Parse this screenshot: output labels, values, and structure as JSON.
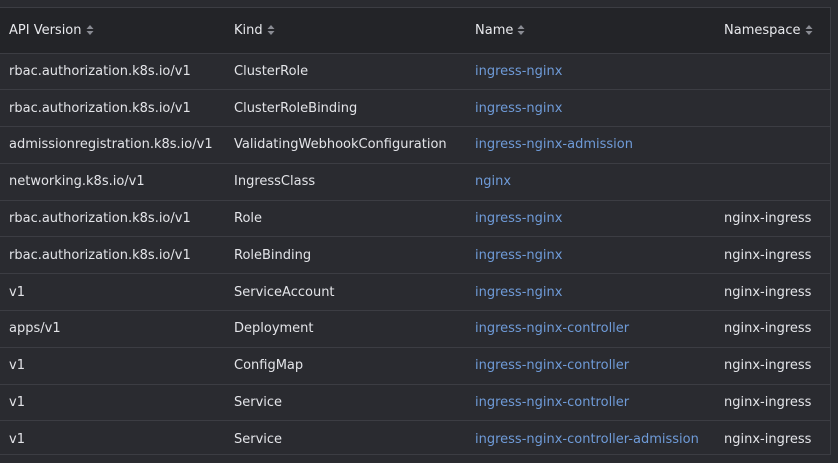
{
  "columns": [
    {
      "label": "API Version",
      "icon": "sort-icon"
    },
    {
      "label": "Kind",
      "icon": "sort-icon"
    },
    {
      "label": "Name",
      "icon": "sort-icon"
    },
    {
      "label": "Namespace",
      "icon": "sort-icon"
    }
  ],
  "colors": {
    "background": "#2a2b30",
    "header_background": "#232428",
    "border": "#3c3d43",
    "text": "#e3e4e8",
    "link": "#6f9bd8"
  },
  "rows": [
    {
      "api_version": "rbac.authorization.k8s.io/v1",
      "kind": "ClusterRole",
      "name": "ingress-nginx",
      "namespace": ""
    },
    {
      "api_version": "rbac.authorization.k8s.io/v1",
      "kind": "ClusterRoleBinding",
      "name": "ingress-nginx",
      "namespace": ""
    },
    {
      "api_version": "admissionregistration.k8s.io/v1",
      "kind": "ValidatingWebhookConfiguration",
      "name": "ingress-nginx-admission",
      "namespace": ""
    },
    {
      "api_version": "networking.k8s.io/v1",
      "kind": "IngressClass",
      "name": "nginx",
      "namespace": ""
    },
    {
      "api_version": "rbac.authorization.k8s.io/v1",
      "kind": "Role",
      "name": "ingress-nginx",
      "namespace": "nginx-ingress"
    },
    {
      "api_version": "rbac.authorization.k8s.io/v1",
      "kind": "RoleBinding",
      "name": "ingress-nginx",
      "namespace": "nginx-ingress"
    },
    {
      "api_version": "v1",
      "kind": "ServiceAccount",
      "name": "ingress-nginx",
      "namespace": "nginx-ingress"
    },
    {
      "api_version": "apps/v1",
      "kind": "Deployment",
      "name": "ingress-nginx-controller",
      "namespace": "nginx-ingress"
    },
    {
      "api_version": "v1",
      "kind": "ConfigMap",
      "name": "ingress-nginx-controller",
      "namespace": "nginx-ingress"
    },
    {
      "api_version": "v1",
      "kind": "Service",
      "name": "ingress-nginx-controller",
      "namespace": "nginx-ingress"
    },
    {
      "api_version": "v1",
      "kind": "Service",
      "name": "ingress-nginx-controller-admission",
      "namespace": "nginx-ingress"
    }
  ]
}
